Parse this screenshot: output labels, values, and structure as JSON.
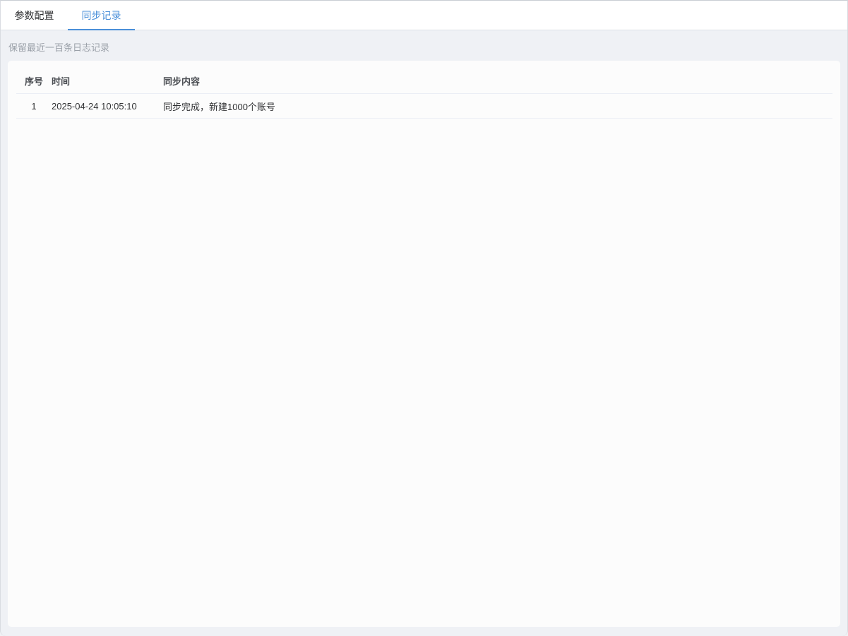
{
  "tabs": [
    {
      "label": "参数配置",
      "active": false
    },
    {
      "label": "同步记录",
      "active": true
    }
  ],
  "hint": "保留最近一百条日志记录",
  "table": {
    "columns": [
      "序号",
      "时间",
      "同步内容"
    ],
    "rows": [
      {
        "index": "1",
        "time": "2025-04-24 10:05:10",
        "content": "同步完成，新建1000个账号"
      }
    ]
  },
  "colors": {
    "accent": "#4a8fd9",
    "page_bg": "#eff1f5",
    "panel_bg": "#fcfcfc"
  }
}
